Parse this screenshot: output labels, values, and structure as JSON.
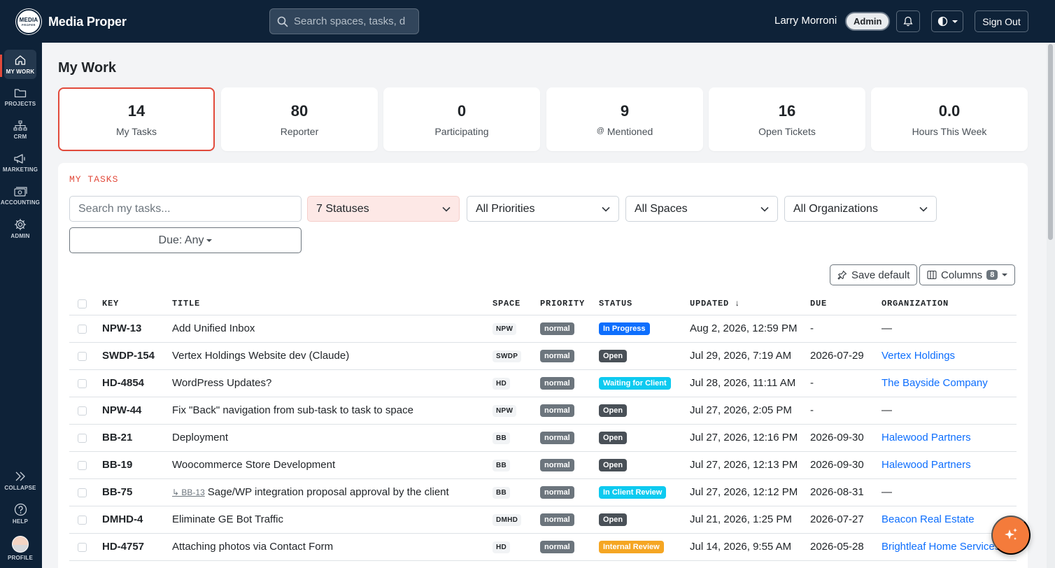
{
  "app": {
    "brand_name": "Media Proper",
    "logo_text": "MEDIA",
    "logo_subtext": "PROPER"
  },
  "header": {
    "search_placeholder": "Search spaces, tasks, d",
    "user_name": "Larry Morroni",
    "role_badge": "Admin",
    "sign_out": "Sign Out"
  },
  "sidebar": {
    "items": [
      {
        "label": "MY WORK",
        "icon": "home-icon"
      },
      {
        "label": "PROJECTS",
        "icon": "folder-icon"
      },
      {
        "label": "CRM",
        "icon": "sitemap-icon"
      },
      {
        "label": "MARKETING",
        "icon": "megaphone-icon"
      },
      {
        "label": "ACCOUNTING",
        "icon": "cash-icon"
      },
      {
        "label": "ADMIN",
        "icon": "gear-icon"
      }
    ],
    "bottom": [
      {
        "label": "COLLAPSE",
        "icon": "collapse-icon"
      },
      {
        "label": "HELP",
        "icon": "help-icon"
      },
      {
        "label": "PROFILE",
        "icon": "avatar"
      }
    ]
  },
  "page": {
    "title": "My Work"
  },
  "stats": [
    {
      "value": "14",
      "label": "My Tasks"
    },
    {
      "value": "80",
      "label": "Reporter"
    },
    {
      "value": "0",
      "label": "Participating"
    },
    {
      "value": "9",
      "label": "Mentioned",
      "prefix": "@"
    },
    {
      "value": "16",
      "label": "Open Tickets"
    },
    {
      "value": "0.0",
      "label": "Hours This Week"
    }
  ],
  "tasks_section": {
    "label": "MY TASKS",
    "search_placeholder": "Search my tasks...",
    "filters": {
      "statuses": "7 Statuses",
      "priorities": "All Priorities",
      "spaces": "All Spaces",
      "organizations": "All Organizations",
      "due": "Due: Any"
    },
    "save_default": "Save default",
    "columns_label": "Columns",
    "columns_count": "8"
  },
  "table": {
    "headers": [
      "KEY",
      "TITLE",
      "SPACE",
      "PRIORITY",
      "STATUS",
      "UPDATED ↓",
      "DUE",
      "ORGANIZATION"
    ],
    "rows": [
      {
        "key": "NPW-13",
        "parent": "",
        "title": "Add Unified Inbox",
        "space": "NPW",
        "priority": "normal",
        "status": "In Progress",
        "status_color": "#0d6efd",
        "updated": "Aug 2, 2026, 12:59 PM",
        "due": "-",
        "org": "—"
      },
      {
        "key": "SWDP-154",
        "parent": "",
        "title": "Vertex Holdings Website dev (Claude)",
        "space": "SWDP",
        "priority": "normal",
        "status": "Open",
        "status_color": "#495057",
        "updated": "Jul 29, 2026, 7:19 AM",
        "due": "2026-07-29",
        "org": "Vertex Holdings"
      },
      {
        "key": "HD-4854",
        "parent": "",
        "title": "WordPress Updates?",
        "space": "HD",
        "priority": "normal",
        "status": "Waiting for Client",
        "status_color": "#0dcaf0",
        "updated": "Jul 28, 2026, 11:11 AM",
        "due": "-",
        "org": "The Bayside Company"
      },
      {
        "key": "NPW-44",
        "parent": "",
        "title": "Fix \"Back\" navigation from sub-task to task to space",
        "space": "NPW",
        "priority": "normal",
        "status": "Open",
        "status_color": "#495057",
        "updated": "Jul 27, 2026, 2:05 PM",
        "due": "-",
        "org": "—"
      },
      {
        "key": "BB-21",
        "parent": "",
        "title": "Deployment",
        "space": "BB",
        "priority": "normal",
        "status": "Open",
        "status_color": "#495057",
        "updated": "Jul 27, 2026, 12:16 PM",
        "due": "2026-09-30",
        "org": "Halewood Partners"
      },
      {
        "key": "BB-19",
        "parent": "",
        "title": "Woocommerce Store Development",
        "space": "BB",
        "priority": "normal",
        "status": "Open",
        "status_color": "#495057",
        "updated": "Jul 27, 2026, 12:13 PM",
        "due": "2026-09-30",
        "org": "Halewood Partners"
      },
      {
        "key": "BB-75",
        "parent": "↳ BB-13",
        "title": "Sage/WP integration proposal approval by the client",
        "space": "BB",
        "priority": "normal",
        "status": "In Client Review",
        "status_color": "#0dcaf0",
        "updated": "Jul 27, 2026, 12:12 PM",
        "due": "2026-08-31",
        "org": "—"
      },
      {
        "key": "DMHD-4",
        "parent": "",
        "title": "Eliminate GE Bot Traffic",
        "space": "DMHD",
        "priority": "normal",
        "status": "Open",
        "status_color": "#495057",
        "updated": "Jul 21, 2026, 1:25 PM",
        "due": "2026-07-27",
        "org": "Beacon Real Estate"
      },
      {
        "key": "HD-4757",
        "parent": "",
        "title": "Attaching photos via Contact Form",
        "space": "HD",
        "priority": "normal",
        "status": "Internal Review",
        "status_color": "#f5a623",
        "updated": "Jul 14, 2026, 9:55 AM",
        "due": "2026-05-28",
        "org": "Brightleaf Home Services"
      }
    ]
  },
  "colors": {
    "navy": "#0e2238",
    "accent": "#e24a3b",
    "link": "#0d6efd",
    "fab": "#f47b3b"
  }
}
